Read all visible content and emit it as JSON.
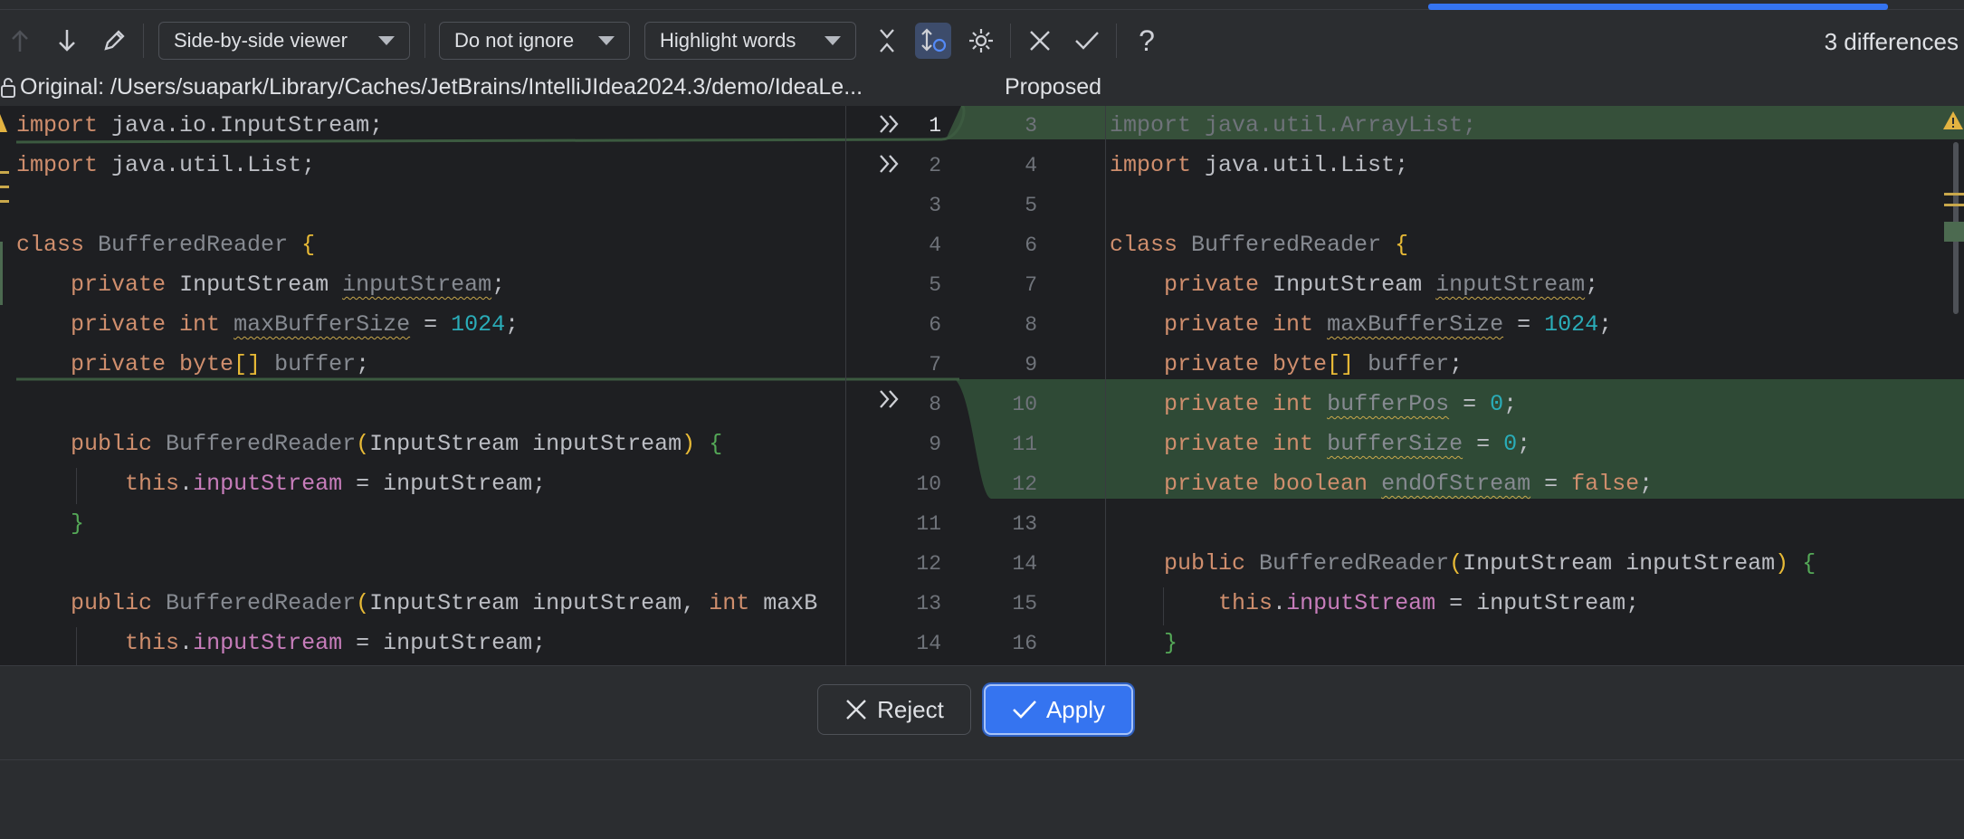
{
  "toolbar": {
    "viewer_mode": "Side-by-side viewer",
    "ignore_mode": "Do not ignore",
    "highlight_mode": "Highlight words",
    "differences": "3 differences"
  },
  "header": {
    "original_label": "Original: /Users/suapark/Library/Caches/JetBrains/IntelliJIdea2024.3/demo/IdeaLe...",
    "proposed_label": "Proposed"
  },
  "gutter": {
    "left_numbers": [
      "1",
      "2",
      "3",
      "4",
      "5",
      "6",
      "7",
      "8",
      "9",
      "10",
      "11",
      "12",
      "13",
      "14"
    ],
    "right_numbers": [
      "3",
      "4",
      "5",
      "6",
      "7",
      "8",
      "9",
      "10",
      "11",
      "12",
      "13",
      "14",
      "15",
      "16"
    ]
  },
  "left_code": [
    "import java.io.InputStream;",
    "import java.util.List;",
    "",
    "class BufferedReader {",
    "    private InputStream inputStream;",
    "    private int maxBufferSize = 1024;",
    "    private byte[] buffer;",
    "",
    "    public BufferedReader(InputStream inputStream) {",
    "        this.inputStream = inputStream;",
    "    }",
    "",
    "    public BufferedReader(InputStream inputStream, int maxB",
    "        this.inputStream = inputStream;"
  ],
  "right_code": [
    "import java.util.ArrayList;",
    "import java.util.List;",
    "",
    "class BufferedReader {",
    "    private InputStream inputStream;",
    "    private int maxBufferSize = 1024;",
    "    private byte[] buffer;",
    "    private int bufferPos = 0;",
    "    private int bufferSize = 0;",
    "    private boolean endOfStream = false;",
    "",
    "    public BufferedReader(InputStream inputStream) {",
    "        this.inputStream = inputStream;",
    "    }"
  ],
  "actions": {
    "reject_label": "Reject",
    "apply_label": "Apply"
  },
  "colors": {
    "accent": "#3574f0",
    "diff_inserted": "#2f4a36",
    "diff_modified_bg": "#36503a"
  }
}
